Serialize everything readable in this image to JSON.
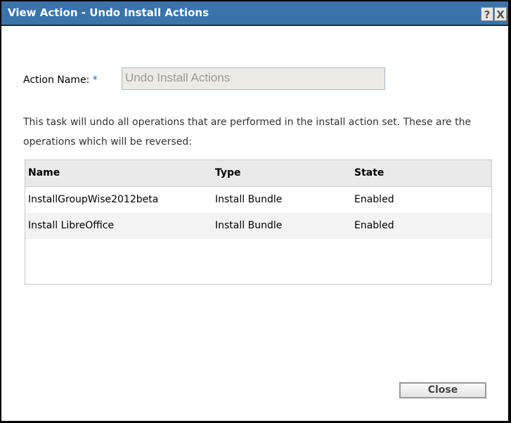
{
  "dialog": {
    "title": "View Action - Undo Install Actions",
    "help_label": "?",
    "close_icon_label": "X"
  },
  "form": {
    "action_name_label": "Action Name:",
    "required_marker": "*",
    "action_name_value": "Undo Install Actions"
  },
  "description": "This task will undo all operations that are performed in the install action set. These are the operations which will be reversed:",
  "table": {
    "headers": [
      "Name",
      "Type",
      "State"
    ],
    "rows": [
      [
        "InstallGroupWise2012beta",
        "Install Bundle",
        "Enabled"
      ],
      [
        "Install LibreOffice",
        "Install Bundle",
        "Enabled"
      ]
    ]
  },
  "buttons": {
    "close": "Close"
  }
}
